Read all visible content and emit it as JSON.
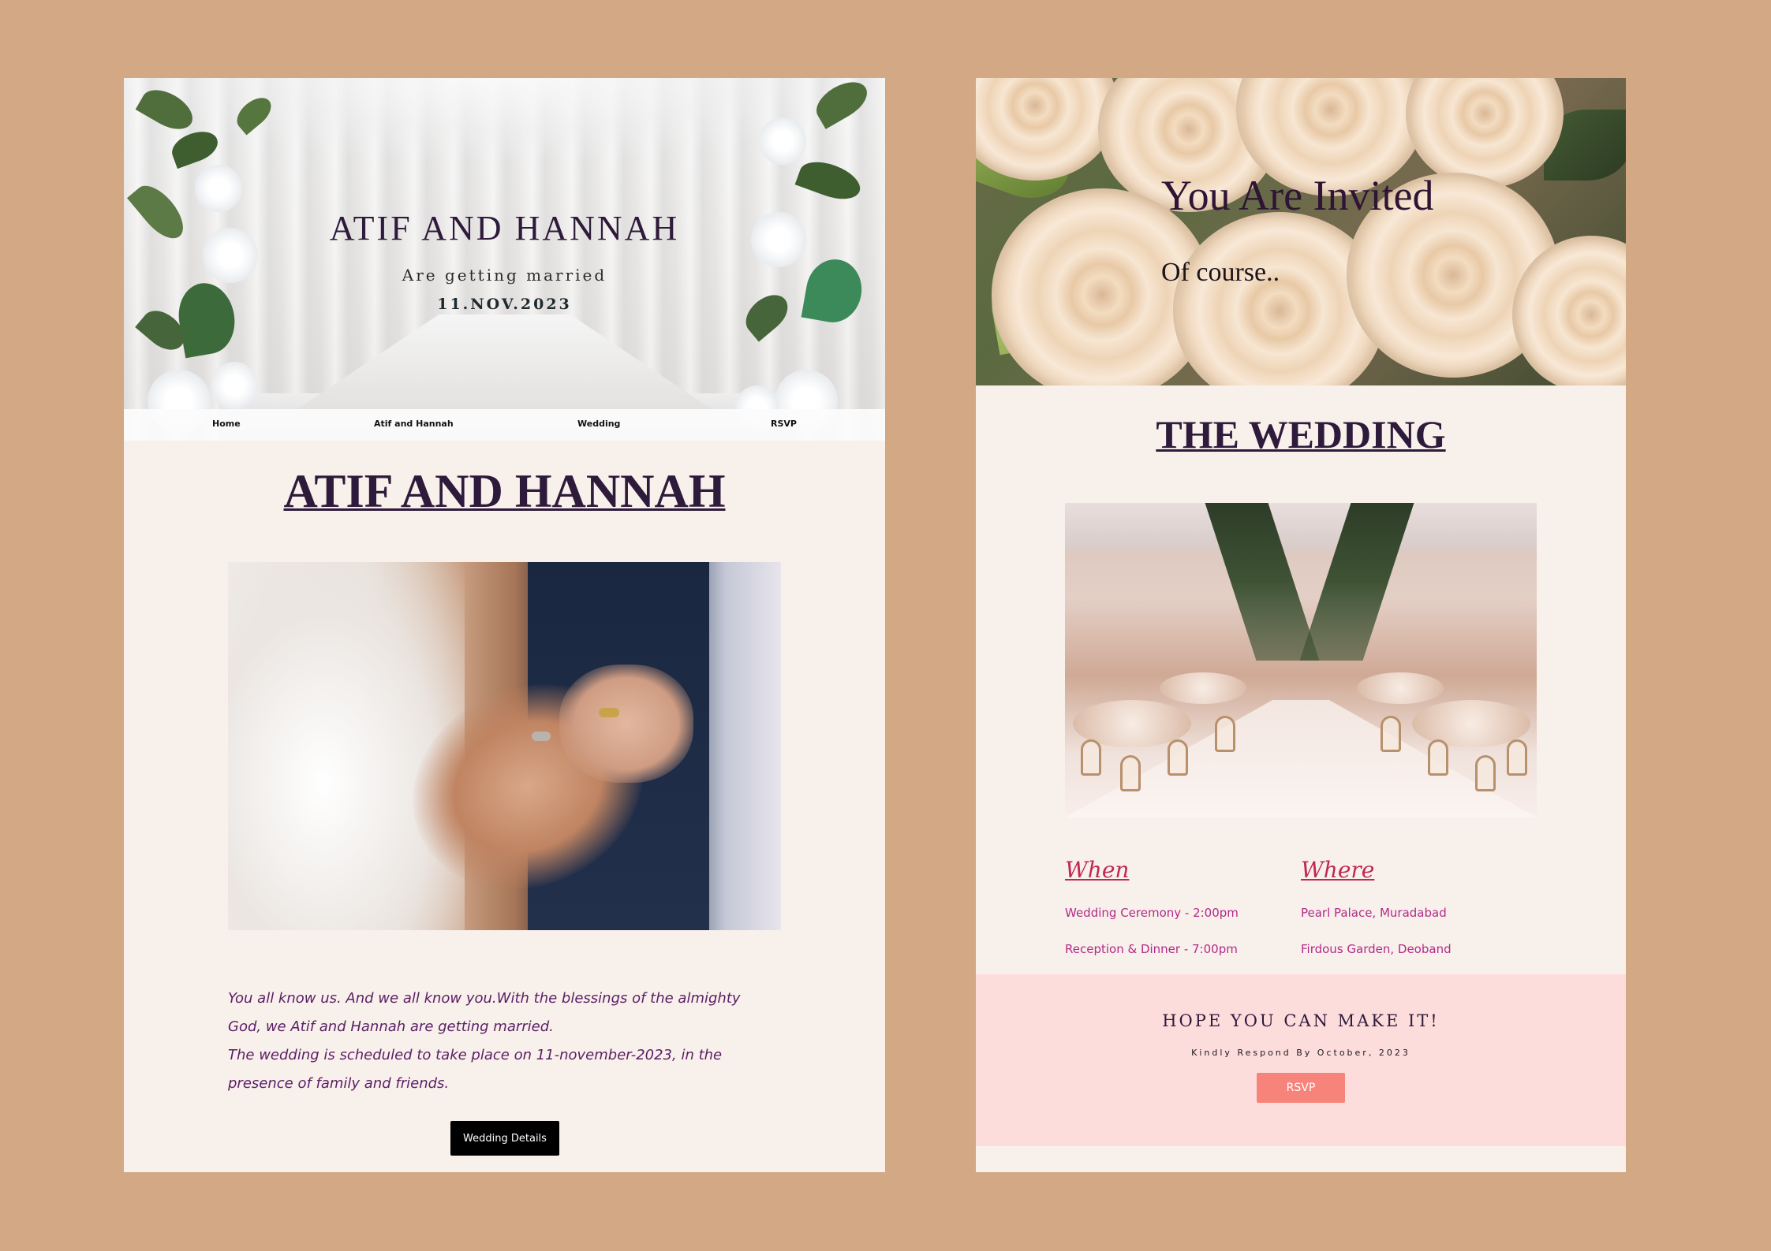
{
  "left_card": {
    "hero": {
      "title": "ATIF AND HANNAH",
      "subtitle": "Are getting married",
      "date": "11.NOV.2023"
    },
    "nav": [
      "Home",
      "Atif and Hannah",
      "Wedding",
      "RSVP"
    ],
    "section_title": "ATIF AND HANNAH",
    "story": [
      "You all know us. And we all know you.With the blessings of the almighty",
      "God, we Atif and Hannah are getting married.",
      "The wedding is scheduled to take place on 11-november-2023, in the",
      "presence of family and friends."
    ],
    "button_label": "Wedding Details"
  },
  "right_card": {
    "hero": {
      "title": "You Are Invited",
      "subtitle": "Of course.."
    },
    "section_title": "THE WEDDING",
    "when": {
      "heading": "When",
      "lines": [
        "Wedding Ceremony - 2:00pm",
        "Reception & Dinner - 7:00pm"
      ]
    },
    "where": {
      "heading": "Where",
      "lines": [
        "Pearl Palace, Muradabad",
        "Firdous Garden, Deoband"
      ]
    },
    "rsvp": {
      "heading": "HOPE YOU CAN MAKE IT!",
      "note": "Kindly Respond By October, 2023",
      "button_label": "RSVP"
    }
  },
  "colors": {
    "background": "#d2a984",
    "card": "#f8f0ea",
    "title": "#2e1a3a",
    "story_text": "#5a1e66",
    "info_heading": "#c0284f",
    "info_text": "#b42a8a",
    "rsvp_band": "#fddcdc",
    "rsvp_button": "#f7847b"
  }
}
